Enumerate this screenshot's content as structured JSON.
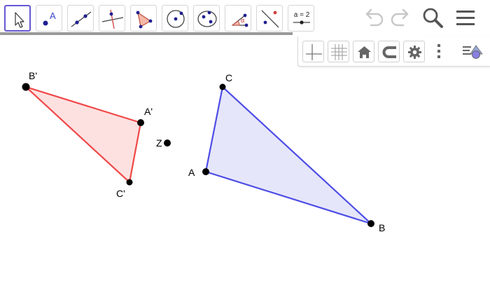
{
  "toolbar": {
    "tools": [
      {
        "name": "move-tool",
        "label": ""
      },
      {
        "name": "point-tool",
        "label": "A"
      },
      {
        "name": "line-tool",
        "label": ""
      },
      {
        "name": "perpendicular-line-tool",
        "label": ""
      },
      {
        "name": "polygon-tool",
        "label": ""
      },
      {
        "name": "circle-center-point-tool",
        "label": ""
      },
      {
        "name": "ellipse-tool",
        "label": ""
      },
      {
        "name": "angle-tool",
        "label": "α"
      },
      {
        "name": "reflect-line-tool",
        "label": ""
      },
      {
        "name": "slider-tool",
        "label": "a = 2"
      }
    ],
    "selected_tool": "move-tool",
    "actions": [
      "undo-icon",
      "redo-icon",
      "search-icon",
      "menu-icon"
    ]
  },
  "graphics_style_bar": {
    "buttons": [
      "axes-toggle-icon",
      "grid-toggle-icon",
      "home-icon",
      "snapping-magnet-icon",
      "settings-gear-icon",
      "more-options-icon",
      "style-bar-toggle-icon"
    ]
  },
  "colors": {
    "accent": "#6557d2",
    "triangle_abc_stroke": "#4d4de6",
    "triangle_abc_fill": "#e6e6fa",
    "triangle_image_stroke": "#f04848",
    "triangle_image_fill": "#fde1e1"
  },
  "construction": {
    "points": {
      "A": "A",
      "B": "B",
      "C": "C",
      "A_prime": "A'",
      "B_prime": "B'",
      "C_prime": "C'",
      "Z": "Z"
    }
  }
}
